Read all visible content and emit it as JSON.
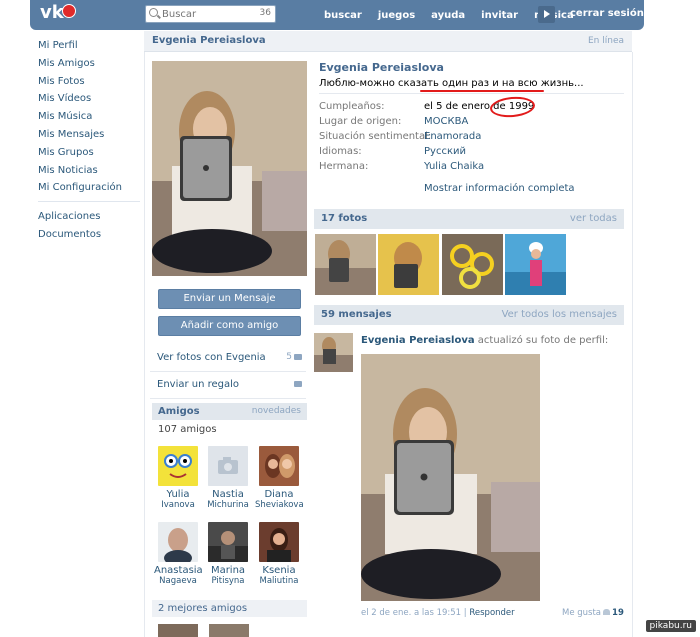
{
  "topbar": {
    "logo_text": "vk",
    "search_placeholder": "Buscar",
    "search_count": "36",
    "nav": [
      "buscar",
      "juegos",
      "ayuda",
      "invitar",
      "música"
    ],
    "logout": "cerrar sesión"
  },
  "leftmenu": {
    "items": [
      "Mi Perfil",
      "Mis Amigos",
      "Mis Fotos",
      "Mis Vídeos",
      "Mis Música",
      "Mis Mensajes",
      "Mis Grupos",
      "Mis Noticias",
      "Mi Configuración"
    ],
    "extra": [
      "Aplicaciones",
      "Documentos"
    ]
  },
  "header": {
    "name": "Evgenia Pereiaslova",
    "online": "En línea"
  },
  "profile": {
    "fullname": "Evgenia Pereiaslova",
    "status": "Люблю-можно сказать один раз и на всю жизнь...",
    "info": [
      {
        "label": "Cumpleaños:",
        "value": "el 5 de enero de 1999"
      },
      {
        "label": "Lugar de origen:",
        "value": "МОСКВА"
      },
      {
        "label": "Situación sentimental:",
        "value": "Enamorada"
      },
      {
        "label": "Idiomas:",
        "value": "Русский"
      },
      {
        "label": "Hermana:",
        "value": "Yulia Chaika"
      }
    ],
    "show_full": "Mostrar información completa"
  },
  "actions": {
    "send_message": "Enviar un Mensaje",
    "add_friend": "Añadir como amigo",
    "see_photos": "Ver fotos con Evgenia",
    "see_photos_count": "5",
    "send_gift": "Enviar un regalo"
  },
  "friends": {
    "title": "Amigos",
    "news": "novedades",
    "count": "107 amigos",
    "list": [
      {
        "first": "Yulia",
        "last": "Ivanova"
      },
      {
        "first": "Nastia",
        "last": "Michurina"
      },
      {
        "first": "Diana",
        "last": "Sheviakova"
      },
      {
        "first": "Anastasia",
        "last": "Nagaeva"
      },
      {
        "first": "Marina",
        "last": "Pitisyna"
      },
      {
        "first": "Ksenia",
        "last": "Maliutina"
      }
    ],
    "best": "2 mejores amigos"
  },
  "photos": {
    "title": "17 fotos",
    "see_all": "ver todas"
  },
  "wall": {
    "title": "59 mensajes",
    "see_all": "Ver todos los mensajes",
    "author": "Evgenia Pereiaslova",
    "action": "actualizó su foto de perfil:",
    "date": "el 2 de ene. a las 19:51",
    "reply": "Responder",
    "like_label": "Me gusta",
    "like_count": "19"
  },
  "watermark": "pikabu.ru",
  "colors": {
    "topbar": "#597da3",
    "link": "#2b587a",
    "button": "#6d8fb3",
    "annotation": "#e21b1b"
  }
}
